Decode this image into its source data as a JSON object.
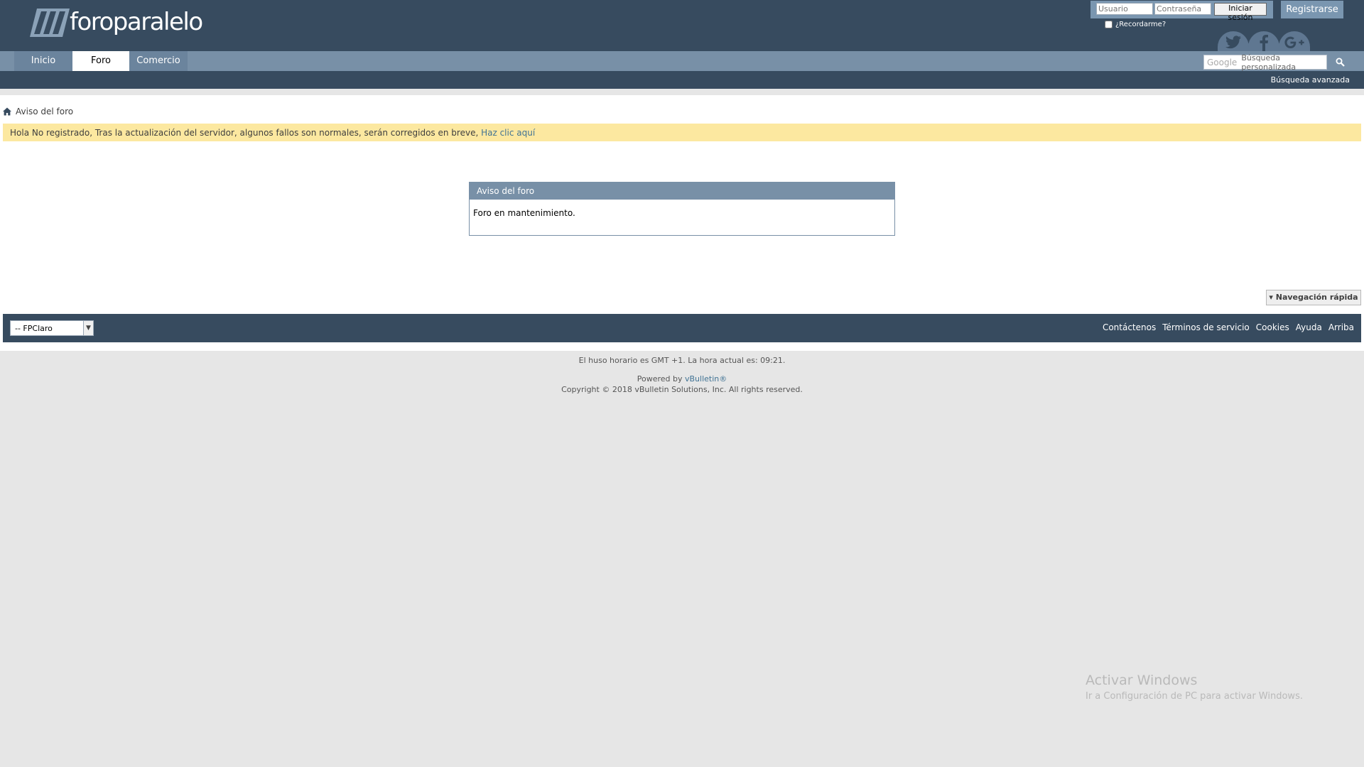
{
  "header": {
    "logo_text": "foroparalelo",
    "login": {
      "username_placeholder": "Usuario",
      "password_placeholder": "Contraseña",
      "login_label": "Iniciar sesión",
      "remember_label": "¿Recordarme?"
    },
    "register_label": "Registrarse",
    "social": [
      "twitter-icon",
      "facebook-icon",
      "google-plus-icon"
    ]
  },
  "nav": {
    "tabs": [
      {
        "label": "Inicio",
        "active": false
      },
      {
        "label": "Foro",
        "active": true
      },
      {
        "label": "Comercio",
        "active": false
      }
    ],
    "search": {
      "brand": "Google",
      "placeholder": "Búsqueda personalizada"
    },
    "advanced_search_label": "Búsqueda avanzada"
  },
  "breadcrumb": {
    "current": "Aviso del foro"
  },
  "notice": {
    "text": "Hola No registrado, Tras la actualización del servidor, algunos fallos son normales, serán corregidos en breve, ",
    "link_label": "Haz clic aquí"
  },
  "panel": {
    "title": "Aviso del foro",
    "message": "Foro en mantenimiento."
  },
  "quick_nav_label": "Navegación rápida",
  "footer": {
    "theme_selected": "-- FPClaro",
    "links": [
      "Contáctenos",
      "Términos de servicio",
      "Cookies",
      "Ayuda",
      "Arriba"
    ]
  },
  "bottom": {
    "timezone_prefix": "El huso horario es GMT +1. La hora actual es: ",
    "time": "09:21",
    "timezone_suffix": ".",
    "powered_by_prefix": "Powered by ",
    "powered_by_link": "vBulletin®",
    "copyright": "Copyright © 2018 vBulletin Solutions, Inc. All rights reserved."
  },
  "watermark": {
    "title": "Activar Windows",
    "subtitle": "Ir a Configuración de PC para activar Windows."
  },
  "colors": {
    "header_bg": "#374b5f",
    "nav_bg": "#7890a7",
    "notice_bg": "#fce8a0",
    "link": "#417394"
  }
}
